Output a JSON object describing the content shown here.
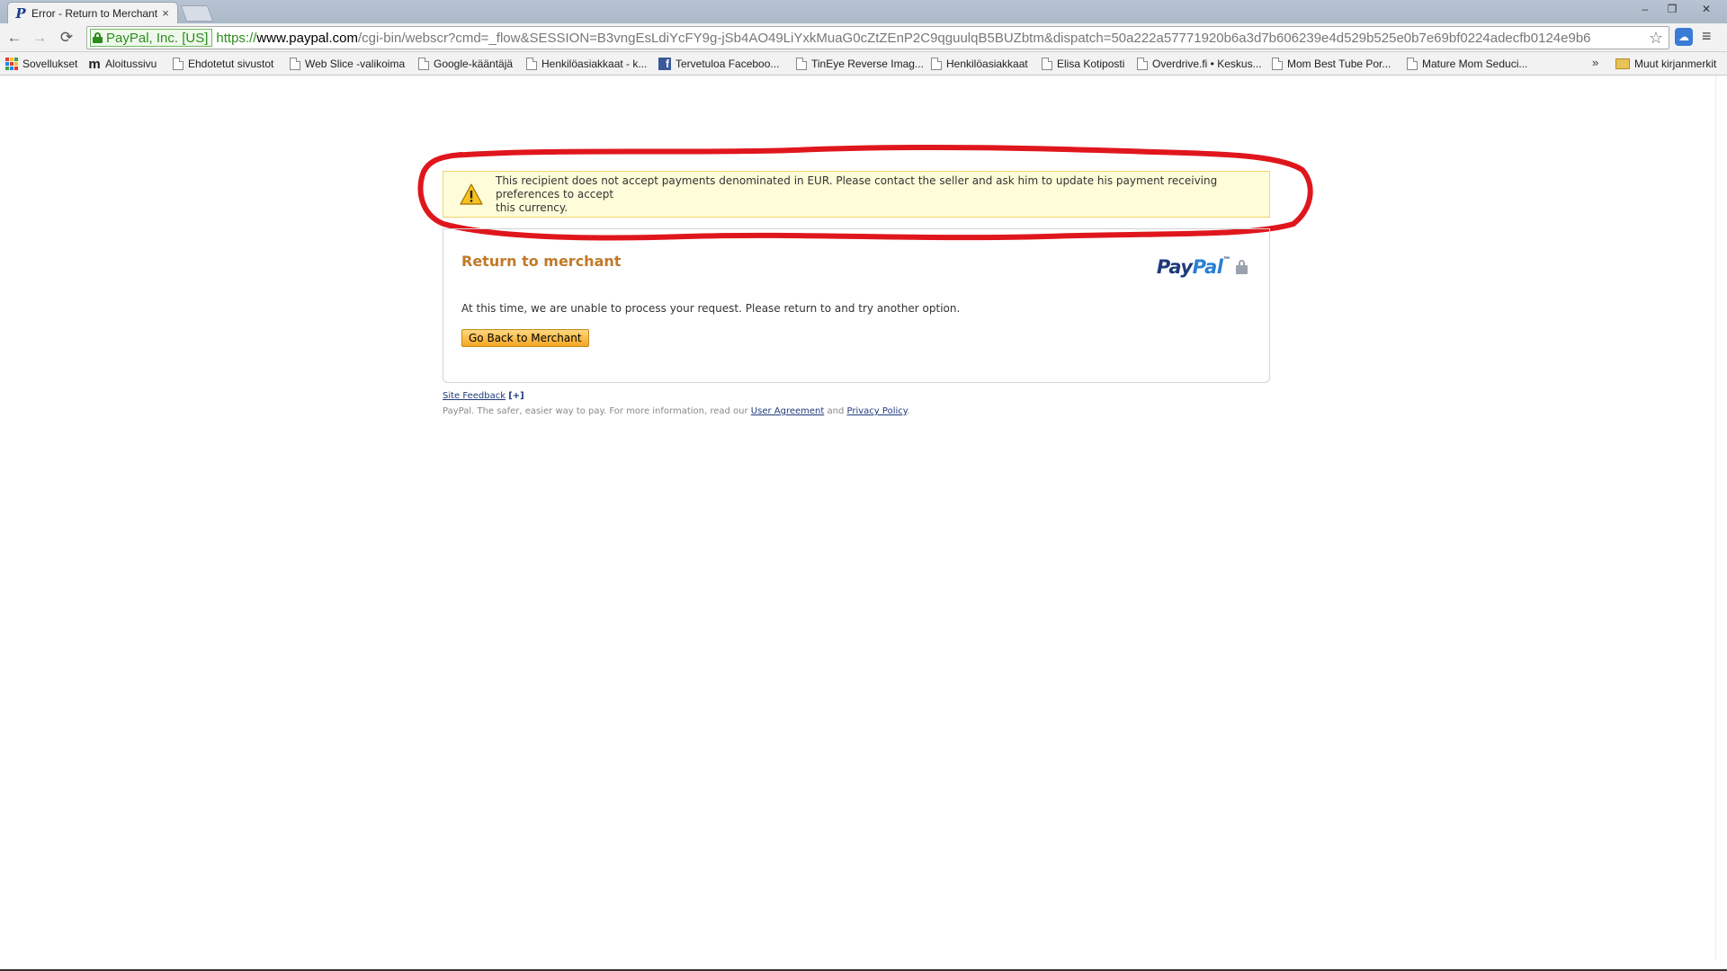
{
  "tab": {
    "title": "Error - Return to Merchant",
    "close": "×"
  },
  "window": {
    "minimize": "–",
    "restore": "❐",
    "close": "✕"
  },
  "toolbar": {
    "back": "←",
    "forward": "→",
    "reload": "⟳",
    "ev_label": "PayPal, Inc. [US]",
    "url_scheme": "https://",
    "url_host": "www.paypal.com",
    "url_path": "/cgi-bin/webscr?cmd=_flow&SESSION=B3vngEsLdiYcFY9g-jSb4AO49LiYxkMuaG0cZtZEnP2C9qguulqB5BUZbtm&dispatch=50a222a57771920b6a3d7b606239e4d529b525e0b7e69bf0224adecfb0124e9b6",
    "star": "☆",
    "menu": "≡"
  },
  "bookmarks": {
    "items": [
      {
        "label": "Sovellukset",
        "icon": "apps-icon"
      },
      {
        "label": "Aloitussivu",
        "icon": "m-icon"
      },
      {
        "label": "Ehdotetut sivustot",
        "icon": "page-icon"
      },
      {
        "label": "Web Slice -valikoima",
        "icon": "page-icon"
      },
      {
        "label": "Google-kääntäjä",
        "icon": "page-icon"
      },
      {
        "label": "Henkilöasiakkaat - k...",
        "icon": "page-icon"
      },
      {
        "label": "Tervetuloa Faceboo...",
        "icon": "facebook-icon"
      },
      {
        "label": "TinEye Reverse Imag...",
        "icon": "page-icon"
      },
      {
        "label": "Henkilöasiakkaat",
        "icon": "page-icon"
      },
      {
        "label": "Elisa Kotiposti",
        "icon": "page-icon"
      },
      {
        "label": "Overdrive.fi • Keskus...",
        "icon": "page-icon"
      },
      {
        "label": "Mom Best Tube Por...",
        "icon": "page-icon"
      },
      {
        "label": "Mature Mom Seduci...",
        "icon": "page-icon"
      }
    ],
    "more": "»",
    "other_label": "Muut kirjanmerkit"
  },
  "alert": {
    "line1": "This recipient does not accept payments denominated in EUR. Please contact the seller and ask him to update his payment receiving preferences to accept",
    "line2": "this currency."
  },
  "panel": {
    "title": "Return to merchant",
    "logo_pay": "Pay",
    "logo_pal": "Pal",
    "logo_tm": "™",
    "message": "At this time, we are unable to process your request. Please return to and try another option.",
    "button": "Go Back to Merchant"
  },
  "footer": {
    "feedback": "Site Feedback",
    "feedback_plus": "[+]",
    "tagline": "PayPal. The safer, easier way to pay. For more information, read our",
    "user_agreement": "User Agreement",
    "and": "and",
    "privacy": "Privacy Policy",
    "period": "."
  },
  "colors": {
    "annotation": "#e0161d",
    "brand_dark": "#1f3a7a",
    "brand_light": "#2a7fd4",
    "title_orange": "#c07a28"
  }
}
